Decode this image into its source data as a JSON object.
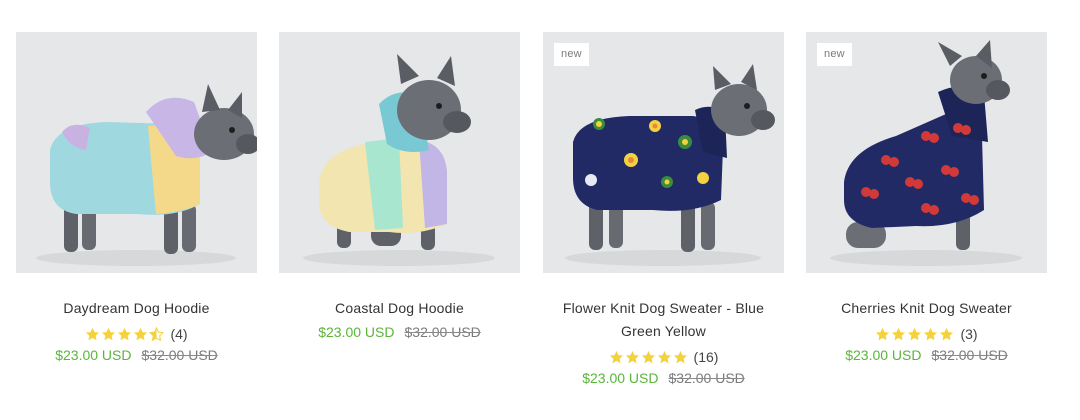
{
  "colors": {
    "sale_price": "#5ab53a",
    "star": "#f4d23c",
    "badge_text": "#7a7a7a",
    "photo_bg": "#e5e7e9"
  },
  "products": [
    {
      "title": "Daydream Dog Hoodie",
      "badge": "",
      "rating": 4.5,
      "review_count": "(4)",
      "price": "$23.00 USD",
      "compare_price": "$32.00 USD",
      "image": "dog-wearing-pastel-hoodie"
    },
    {
      "title": "Coastal Dog Hoodie",
      "badge": "",
      "rating": null,
      "review_count": "",
      "price": "$23.00 USD",
      "compare_price": "$32.00 USD",
      "image": "dog-wearing-teal-pastel-hoodie"
    },
    {
      "title_line1": "Flower Knit Dog Sweater - Blue",
      "title_line2": "Green Yellow",
      "badge": "new",
      "rating": 5,
      "review_count": "(16)",
      "price": "$23.00 USD",
      "compare_price": "$32.00 USD",
      "image": "dog-wearing-flower-knit-sweater"
    },
    {
      "title": "Cherries Knit Dog Sweater",
      "badge": "new",
      "rating": 5,
      "review_count": "(3)",
      "price": "$23.00 USD",
      "compare_price": "$32.00 USD",
      "image": "dog-wearing-cherries-knit-sweater"
    }
  ]
}
